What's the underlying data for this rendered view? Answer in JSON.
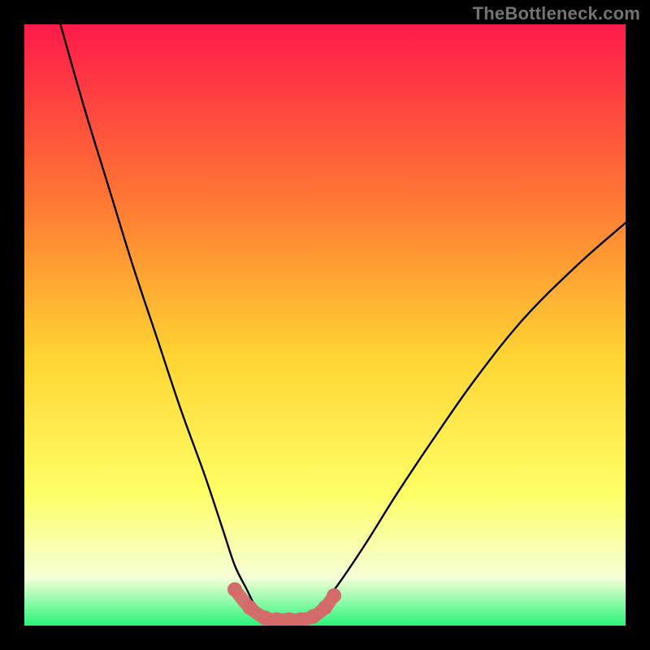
{
  "watermark": "TheBottleneck.com",
  "chart_data": {
    "type": "line",
    "title": "",
    "xlabel": "",
    "ylabel": "",
    "xlim": [
      0,
      100
    ],
    "ylim": [
      0,
      100
    ],
    "grid": false,
    "legend": false,
    "series": [
      {
        "name": "left-branch",
        "x": [
          6,
          10,
          14,
          18,
          22,
          26,
          30,
          33,
          35,
          37,
          38.5,
          40
        ],
        "y": [
          100,
          86,
          73,
          60,
          48,
          36,
          25,
          16,
          10,
          6,
          3,
          1
        ]
      },
      {
        "name": "right-branch",
        "x": [
          47,
          50,
          53,
          57,
          62,
          68,
          75,
          83,
          92,
          100
        ],
        "y": [
          1,
          4,
          8,
          14,
          22,
          31,
          41,
          51,
          60,
          67
        ]
      },
      {
        "name": "valley-markers",
        "x": [
          35,
          37.5,
          40,
          42,
          44,
          46,
          48,
          50,
          51.5
        ],
        "y": [
          6,
          3,
          1.3,
          1,
          1,
          1,
          1.5,
          3,
          5
        ]
      }
    ],
    "background_gradient": {
      "top": "#ff1a4a",
      "mid_upper": "#ff7a33",
      "mid": "#ffd433",
      "mid_lower": "#ffff66",
      "pale": "#f6ffd7",
      "bottom": "#29f47a"
    },
    "marker_color": "#d46a6a",
    "line_color": "#000000"
  }
}
